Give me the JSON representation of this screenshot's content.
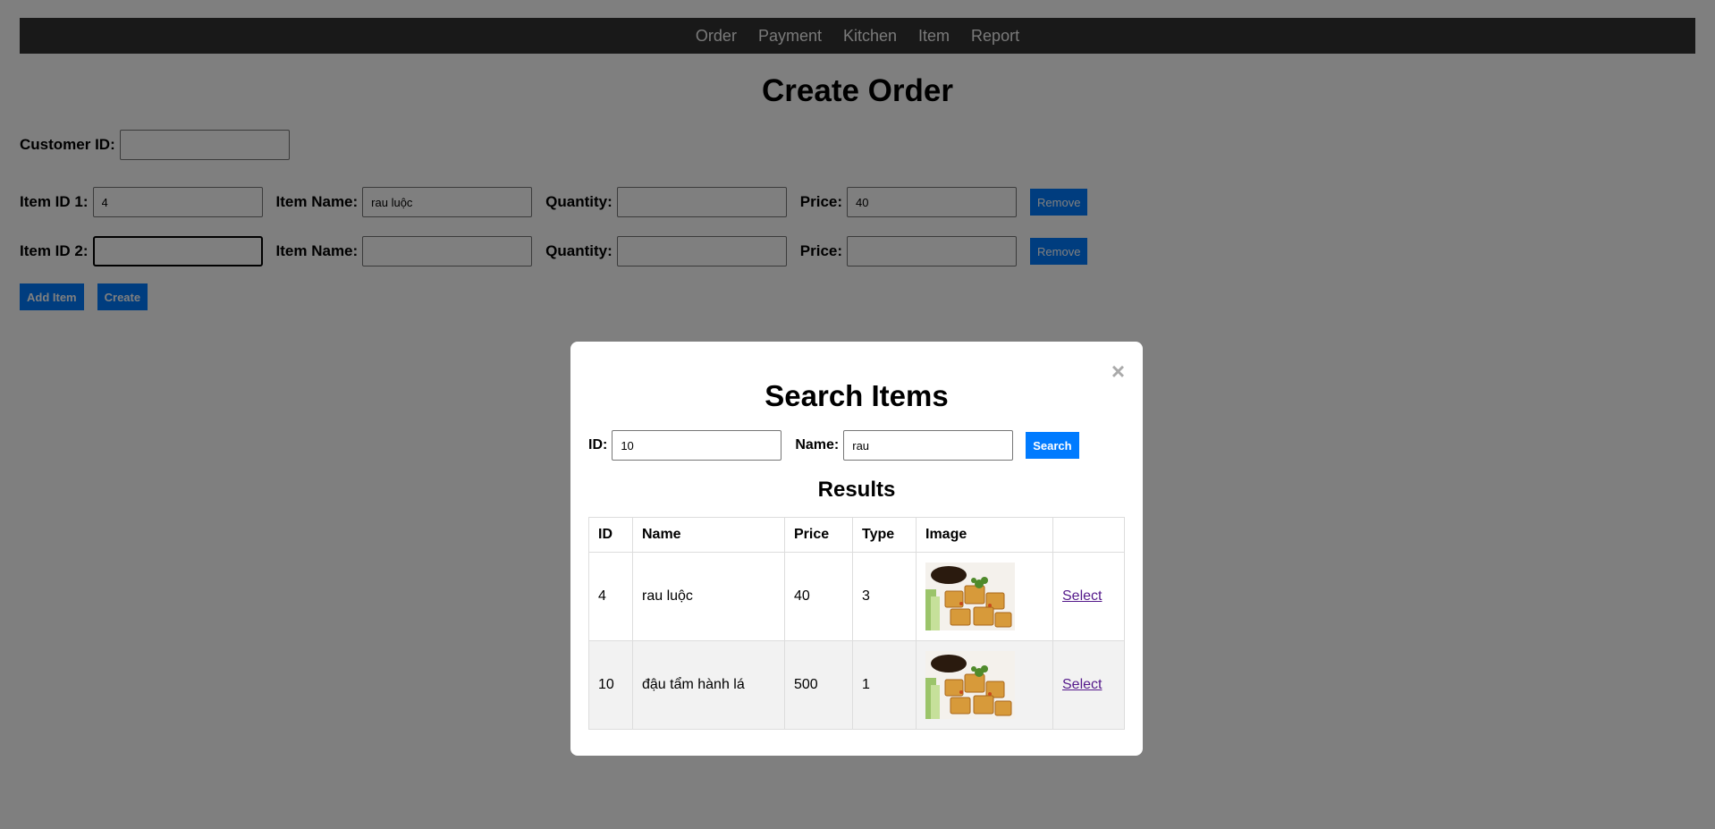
{
  "nav": {
    "items": [
      "Order",
      "Payment",
      "Kitchen",
      "Item",
      "Report"
    ]
  },
  "page": {
    "title": "Create Order"
  },
  "customer": {
    "label": "Customer ID:",
    "value": ""
  },
  "order_items": [
    {
      "id_label": "Item ID 1:",
      "id_value": "4",
      "name_label": "Item Name:",
      "name_value": "rau luộc",
      "qty_label": "Quantity:",
      "qty_value": "",
      "price_label": "Price:",
      "price_value": "40",
      "remove_label": "Remove"
    },
    {
      "id_label": "Item ID 2:",
      "id_value": "",
      "name_label": "Item Name:",
      "name_value": "",
      "qty_label": "Quantity:",
      "qty_value": "",
      "price_label": "Price:",
      "price_value": "",
      "remove_label": "Remove"
    }
  ],
  "actions": {
    "add_item_label": "Add Item",
    "create_label": "Create"
  },
  "modal": {
    "close_glyph": "×",
    "title": "Search Items",
    "id_label": "ID:",
    "id_value": "10",
    "name_label": "Name:",
    "name_value": "rau",
    "search_label": "Search",
    "results_title": "Results",
    "columns": [
      "ID",
      "Name",
      "Price",
      "Type",
      "Image",
      ""
    ],
    "rows": [
      {
        "id": "4",
        "name": "rau luộc",
        "price": "40",
        "type": "3",
        "image": "fried-tofu-image",
        "action": "Select"
      },
      {
        "id": "10",
        "name": "đậu tẩm hành lá",
        "price": "500",
        "type": "1",
        "image": "fried-tofu-image",
        "action": "Select"
      }
    ]
  },
  "colors": {
    "navbar": "#333333",
    "button": "#007bff",
    "overlay": "rgba(0,0,0,0.5)",
    "link_visited": "#551a8b"
  }
}
